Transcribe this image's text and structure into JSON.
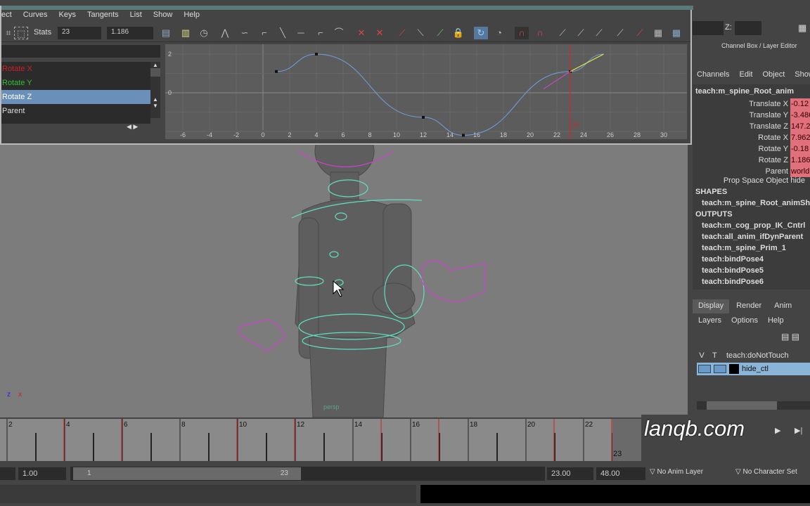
{
  "graph_editor": {
    "menu": [
      "ect",
      "Curves",
      "Keys",
      "Tangents",
      "List",
      "Show",
      "Help"
    ],
    "stats_label": "Stats",
    "stats_frame": "23",
    "stats_value": "1.186",
    "channels": [
      {
        "label": "Rotate X",
        "color": "#d02020"
      },
      {
        "label": "Rotate Y",
        "color": "#30c030"
      },
      {
        "label": "Rotate Z",
        "color": "#ffffff",
        "selected": true
      },
      {
        "label": "Parent",
        "color": "#dddddd"
      }
    ],
    "y_ticks": [
      "2",
      "0"
    ],
    "x_ticks": [
      "-6",
      "-4",
      "-2",
      "0",
      "2",
      "4",
      "6",
      "8",
      "10",
      "12",
      "14",
      "16",
      "18",
      "20",
      "22",
      "24",
      "26",
      "28",
      "30"
    ],
    "curve_keys": [
      [
        1,
        1.1
      ],
      [
        4,
        2.0
      ],
      [
        12,
        -1.27
      ],
      [
        15,
        -2.2
      ],
      [
        23,
        1.1
      ],
      [
        25.5,
        2.0
      ]
    ],
    "current_frame": "23",
    "curve_color": "#6ea0e0"
  },
  "channel_box": {
    "z_label": "Z:",
    "title": "Channel Box / Layer Editor",
    "menu": [
      "Channels",
      "Edit",
      "Object",
      "Show"
    ],
    "node": "teach:m_spine_Root_anim",
    "attributes": [
      {
        "name": "Translate X",
        "value": "-0.12"
      },
      {
        "name": "Translate Y",
        "value": "-3.486"
      },
      {
        "name": "Translate Z",
        "value": "147.2"
      },
      {
        "name": "Rotate X",
        "value": "7.962"
      },
      {
        "name": "Rotate Y",
        "value": "-0.18"
      },
      {
        "name": "Rotate Z",
        "value": "1.186"
      },
      {
        "name": "Parent",
        "value": "world"
      }
    ],
    "prop_space": "Prop Space Object hide",
    "shapes_header": "SHAPES",
    "shapes": [
      "teach:m_spine_Root_animShape"
    ],
    "outputs_header": "OUTPUTS",
    "outputs": [
      "teach:m_cog_prop_IK_Cntrl",
      "teach:all_anim_ifDynParent",
      "teach:m_spine_Prim_1",
      "teach:bindPose4",
      "teach:bindPose5",
      "teach:bindPose6"
    ]
  },
  "layer_editor": {
    "tabs": [
      "Display",
      "Render",
      "Anim"
    ],
    "menu": [
      "Layers",
      "Options",
      "Help"
    ],
    "layers": [
      {
        "v": "V",
        "t": "T",
        "name": "teach:doNotTouch"
      },
      {
        "v": "",
        "t": "",
        "name": "hide_ctl"
      }
    ]
  },
  "viewport": {
    "axis_x": "x",
    "axis_z": "z",
    "camera_label": "persp"
  },
  "timeline": {
    "labels": [
      "2",
      "4",
      "6",
      "8",
      "10",
      "12",
      "14",
      "16",
      "18",
      "20",
      "22"
    ],
    "keys": [
      4,
      6,
      10,
      12,
      15,
      17,
      21,
      23
    ],
    "current_frame": "23",
    "watermark": "lanqb.com"
  },
  "range": {
    "start": "1.00",
    "range_start": "1",
    "range_end": "23",
    "end": "23.00",
    "anim_end": "48.00",
    "anim_layer": "No Anim Layer",
    "character_set": "No Character Set"
  }
}
